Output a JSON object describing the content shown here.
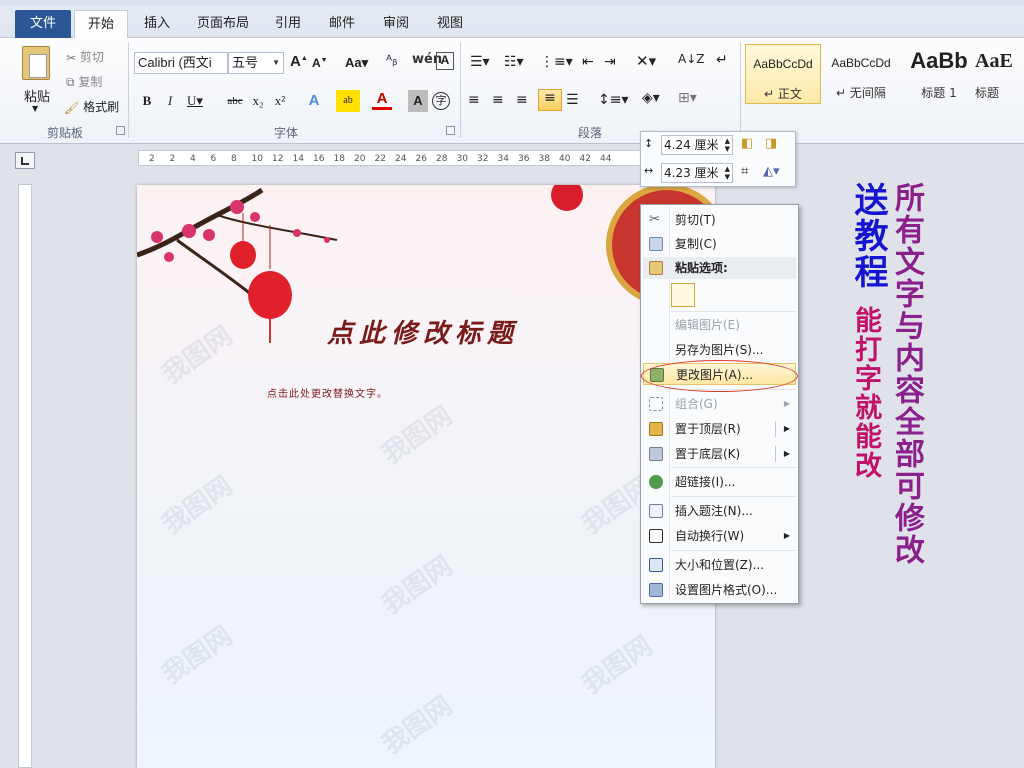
{
  "tabs": [
    {
      "label": "文件"
    },
    {
      "label": "开始"
    },
    {
      "label": "插入"
    },
    {
      "label": "页面布局"
    },
    {
      "label": "引用"
    },
    {
      "label": "邮件"
    },
    {
      "label": "审阅"
    },
    {
      "label": "视图"
    }
  ],
  "ribbon": {
    "clipboard": {
      "paste": "粘贴",
      "cut": "剪切",
      "copy": "复制",
      "format_painter": "格式刷",
      "group_label": "剪贴板"
    },
    "font": {
      "font_name": "Calibri (西文i",
      "font_size": "五号",
      "group_label": "字体"
    },
    "paragraph": {
      "group_label": "段落"
    },
    "styles": [
      {
        "sample": "AaBbCcDd",
        "name": "正文"
      },
      {
        "sample": "AaBbCcDd",
        "name": "无间隔"
      },
      {
        "sample": "AaBb",
        "name": "标题 1"
      },
      {
        "sample": "AaE",
        "name": "标题"
      }
    ]
  },
  "ruler": {
    "ticks": [
      "2",
      "2",
      "4",
      "6",
      "8",
      "10",
      "12",
      "14",
      "16",
      "18",
      "20",
      "22",
      "24",
      "26",
      "28",
      "30",
      "32",
      "34",
      "36",
      "38",
      "40",
      "42",
      "44"
    ]
  },
  "document": {
    "title": "点此修改标题",
    "body": "点击此处更改替换文字。",
    "watermark": "我图网"
  },
  "mini_toolbar": {
    "height": "4.24 厘米",
    "width": "4.23 厘米"
  },
  "context_menu": {
    "cut": "剪切(T)",
    "copy": "复制(C)",
    "paste_options": "粘贴选项:",
    "edit_picture": "编辑图片(E)",
    "save_as_picture": "另存为图片(S)...",
    "change_picture": "更改图片(A)...",
    "group": "组合(G)",
    "bring_to_front": "置于顶层(R)",
    "send_to_back": "置于底层(K)",
    "hyperlink": "超链接(I)...",
    "insert_caption": "插入题注(N)...",
    "wrap_text": "自动换行(W)",
    "size_position": "大小和位置(Z)...",
    "format_picture": "设置图片格式(O)..."
  },
  "overlay_text": {
    "send_tutorial": "送教程",
    "all_editable": "所有文字与内容全部可修改",
    "type_change": "能打字就能改"
  },
  "colors": {
    "file_tab": "#2b5797",
    "title_red": "#7b1a1a",
    "highlight": "#fde7a3",
    "overlay_blue": "#1414d2",
    "overlay_purple": "#8b1f8b",
    "overlay_magenta": "#c0126a"
  }
}
